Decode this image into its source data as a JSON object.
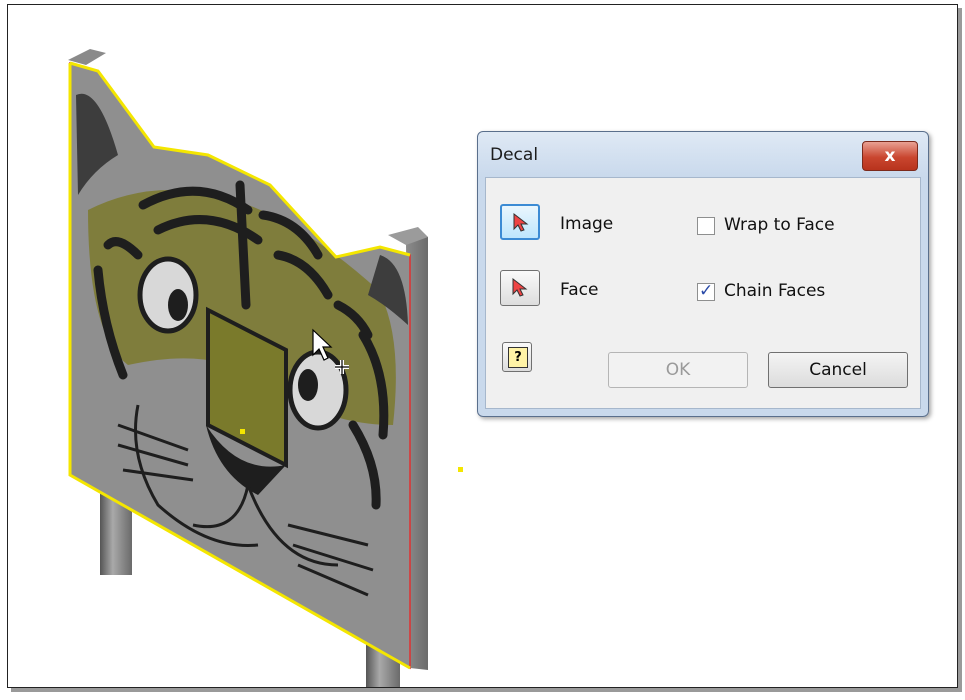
{
  "dialog": {
    "title": "Decal",
    "close_glyph": "x",
    "image_label": "Image",
    "face_label": "Face",
    "wrap_to_face_label": "Wrap to Face",
    "wrap_to_face_checked": false,
    "chain_faces_label": "Chain Faces",
    "chain_faces_checked": true,
    "help_glyph": "?",
    "ok_label": "OK",
    "ok_enabled": false,
    "cancel_label": "Cancel"
  },
  "scene": {
    "object": "tiger-face-sign",
    "selection_color": "#f4e600",
    "edge_highlight_color": "#e03030"
  },
  "cursor": "select-arrow-plus-icon"
}
